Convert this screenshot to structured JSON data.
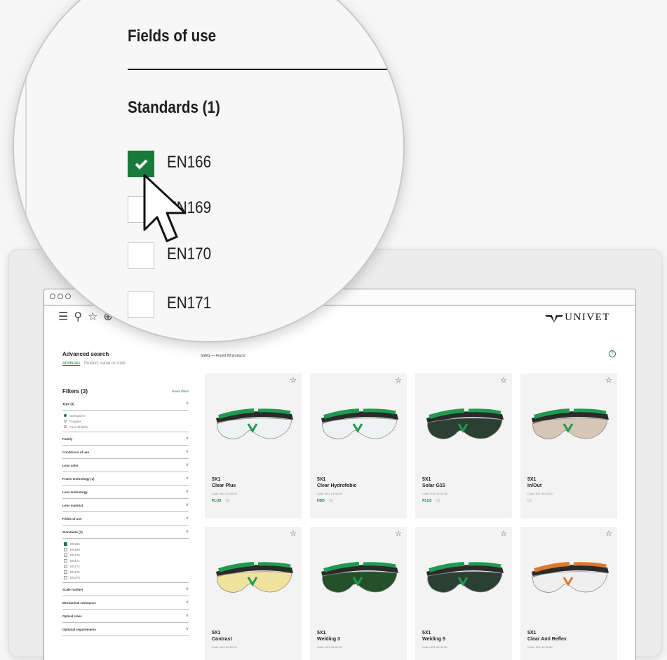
{
  "magnifier": {
    "section_title": "Fields of use",
    "group_title": "Standards (1)",
    "items": [
      {
        "label": "EN166",
        "checked": true
      },
      {
        "label": "EN169",
        "checked": false
      },
      {
        "label": "EN170",
        "checked": false
      },
      {
        "label": "EN171",
        "checked": false
      }
    ]
  },
  "brand": {
    "name": "UNIVET",
    "accent": "#1a7a3c"
  },
  "nav": {
    "icons": [
      "menu-icon",
      "search-icon",
      "star-icon",
      "globe-icon"
    ]
  },
  "sidebar": {
    "title": "Advanced search",
    "tab_active": "Attributes",
    "tab_other": "Product name or code",
    "filters_title": "Filters (3)",
    "reset_label": "Reset filters",
    "type_label": "Type (1)",
    "type_options": [
      {
        "label": "Spectacles",
        "selected": true
      },
      {
        "label": "Goggles",
        "selected": false
      },
      {
        "label": "Face Shields",
        "selected": false
      }
    ],
    "rows_top": [
      "Family",
      "Conditions of use",
      "Lens color",
      "Frame technology (1)",
      "Lens technology",
      "Lens material",
      "Fields of use"
    ],
    "standards_label": "Standards (1)",
    "standards": [
      {
        "label": "EN166",
        "checked": true
      },
      {
        "label": "EN169",
        "checked": false
      },
      {
        "label": "EN170",
        "checked": false
      },
      {
        "label": "EN171",
        "checked": false
      },
      {
        "label": "EN172",
        "checked": false
      },
      {
        "label": "EN175",
        "checked": false
      },
      {
        "label": "EN379",
        "checked": false
      }
    ],
    "rows_bottom": [
      "Scale number",
      "Mechanical resistance",
      "Optical class",
      "Optional requirements"
    ]
  },
  "results": {
    "text": "Safety — Found 28 products",
    "help": "?"
  },
  "products": [
    {
      "series": "5X1",
      "name": "Clear Plus",
      "code": "Code: 5X1.03.00.00",
      "badges": [
        "PLUS",
        "(3)"
      ],
      "lens": "clear"
    },
    {
      "series": "5X1",
      "name": "Clear Hydrofobic",
      "code": "Code: 5X1.24.00.00",
      "badges": [
        "HDD",
        "(3)"
      ],
      "lens": "clear"
    },
    {
      "series": "5X1",
      "name": "Solar G15",
      "code": "Code: 5X1.03.00.05",
      "badges": [
        "PLUS",
        "(3)"
      ],
      "lens": "dark"
    },
    {
      "series": "5X1",
      "name": "In/Out",
      "code": "Code: 5X1.30.00.00",
      "badges": [
        "(3)"
      ],
      "lens": "inout"
    },
    {
      "series": "5X1",
      "name": "Contrast",
      "code": "Code: 5X1.03.00.03",
      "badges": [],
      "lens": "yellow"
    },
    {
      "series": "5X1",
      "name": "Welding 3",
      "code": "Code: 5X1.00.00.30",
      "badges": [],
      "lens": "green"
    },
    {
      "series": "5X1",
      "name": "Welding 5",
      "code": "Code: 5X1.06.00.50",
      "badges": [],
      "lens": "dark"
    },
    {
      "series": "5X1",
      "name": "Clear Anti Reflex",
      "code": "Code: 5X1.40.00.00",
      "badges": [],
      "lens": "clear-orange"
    }
  ]
}
